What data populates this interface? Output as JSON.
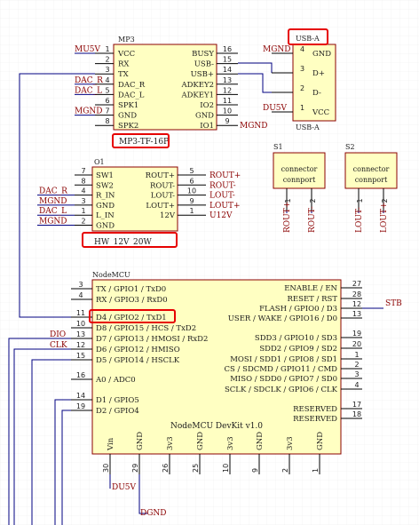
{
  "colors": {
    "body_fill": "#ffffc2",
    "body_stroke": "#8b0000",
    "wire": "#000080",
    "net_label": "#8b0000",
    "highlight": "#e60000",
    "grid": "#e6e6e6"
  },
  "components": {
    "mp3": {
      "designator": "MP3",
      "comment": "MP3-TF-16P",
      "left_pins": [
        {
          "num": "1",
          "name": "VCC",
          "net": "MU5V"
        },
        {
          "num": "2",
          "name": "RX",
          "net": ""
        },
        {
          "num": "3",
          "name": "TX",
          "net": ""
        },
        {
          "num": "4",
          "name": "DAC_R",
          "net": "DAC_R"
        },
        {
          "num": "5",
          "name": "DAC_L",
          "net": "DAC_L"
        },
        {
          "num": "6",
          "name": "SPK1",
          "net": ""
        },
        {
          "num": "7",
          "name": "GND",
          "net": "MGND"
        },
        {
          "num": "8",
          "name": "SPK2",
          "net": ""
        }
      ],
      "right_pins": [
        {
          "num": "16",
          "name": "BUSY",
          "net": ""
        },
        {
          "num": "15",
          "name": "USB-",
          "net": ""
        },
        {
          "num": "14",
          "name": "USB+",
          "net": ""
        },
        {
          "num": "13",
          "name": "ADKEY2",
          "net": ""
        },
        {
          "num": "12",
          "name": "ADKEY1",
          "net": ""
        },
        {
          "num": "11",
          "name": "IO2",
          "net": ""
        },
        {
          "num": "10",
          "name": "GND",
          "net": ""
        },
        {
          "num": "9",
          "name": "IO1",
          "net": "MGND"
        }
      ]
    },
    "usb": {
      "designator": "USB-A",
      "comment": "USB-A",
      "pins": [
        {
          "num": "4",
          "name": "GND",
          "net": "MGND"
        },
        {
          "num": "3",
          "name": "D+",
          "net": ""
        },
        {
          "num": "2",
          "name": "D-",
          "net": ""
        },
        {
          "num": "1",
          "name": "VCC",
          "net": "DU5V"
        }
      ]
    },
    "s1": {
      "designator": "S1",
      "line1": "connector",
      "line2": "connport",
      "pins": [
        {
          "num": "1",
          "net": "ROUT+"
        },
        {
          "num": "2",
          "net": "ROUT-"
        }
      ]
    },
    "s2": {
      "designator": "S2",
      "line1": "connector",
      "line2": "connport",
      "pins": [
        {
          "num": "1",
          "net": "LOUT-"
        },
        {
          "num": "2",
          "net": "LOUT+"
        }
      ]
    },
    "amp": {
      "designator": "O1",
      "comment": "HW_12V_20W",
      "left_pins": [
        {
          "num": "7",
          "name": "SW1",
          "net": ""
        },
        {
          "num": "8",
          "name": "SW2",
          "net": ""
        },
        {
          "num": "4",
          "name": "R_IN",
          "net": "DAC_R"
        },
        {
          "num": "3",
          "name": "GND",
          "net": "MGND"
        },
        {
          "num": "1",
          "name": "L_IN",
          "net": "DAC_L"
        },
        {
          "num": "2",
          "name": "GND",
          "net": "MGND"
        }
      ],
      "right_pins": [
        {
          "num": "5",
          "name": "ROUT+",
          "net": "ROUT+"
        },
        {
          "num": "6",
          "name": "ROUT-",
          "net": "ROUT-"
        },
        {
          "num": "10",
          "name": "LOUT-",
          "net": "LOUT-"
        },
        {
          "num": "9",
          "name": "LOUT+",
          "net": "LOUT+"
        },
        {
          "num": "1",
          "name": "12V",
          "net": "U12V"
        }
      ]
    },
    "mcu": {
      "designator": "NodeMCU",
      "comment": "NodeMCU DevKit v1.0",
      "left_pins": [
        {
          "num": "3",
          "name": "TX / GPIO1 / TxD0",
          "net": ""
        },
        {
          "num": "4",
          "name": "RX / GPIO3 / RxD0",
          "net": ""
        },
        {
          "num": "11",
          "name": "D4 / GPIO2 / TxD1",
          "net": ""
        },
        {
          "num": "10",
          "name": "D8 / GPIO15 / HCS / TxD2",
          "net": ""
        },
        {
          "num": "13",
          "name": "D7 / GPIO13 / HMOSI / RxD2",
          "net": "DIO"
        },
        {
          "num": "12",
          "name": "D6 / GPIO12 / HMISO",
          "net": "CLK"
        },
        {
          "num": "15",
          "name": "D5 / GPIO14 / HSCLK",
          "net": ""
        },
        {
          "num": "16",
          "name": "A0 / ADC0",
          "net": ""
        },
        {
          "num": "14",
          "name": "D1 / GPIO5",
          "net": ""
        },
        {
          "num": "19",
          "name": "D2 / GPIO4",
          "net": ""
        }
      ],
      "right_pins": [
        {
          "num": "27",
          "name": "ENABLE / EN",
          "net": ""
        },
        {
          "num": "28",
          "name": "RESET / RST",
          "net": ""
        },
        {
          "num": "12",
          "name": "FLASH / GPIO0 / D3",
          "net": "STB"
        },
        {
          "num": "13",
          "name": "USER / WAKE / GPIO16 / D0",
          "net": ""
        },
        {
          "num": "19",
          "name": "SDD3 / GPIO10 / SD3",
          "net": ""
        },
        {
          "num": "20",
          "name": "SDD2 / GPIO9 / SD2",
          "net": ""
        },
        {
          "num": "1",
          "name": "MOSI / SDD1 / GPIO8 / SD1",
          "net": ""
        },
        {
          "num": "2",
          "name": "CS / SDCMD / GPIO11 / CMD",
          "net": ""
        },
        {
          "num": "3",
          "name": "MISO / SDD0 / GPIO7 / SD0",
          "net": ""
        },
        {
          "num": "4",
          "name": "SCLK / SDCLK / GPIO6 / CLK",
          "net": ""
        },
        {
          "num": "17",
          "name": "RESERVED",
          "net": ""
        },
        {
          "num": "18",
          "name": "RESERVED",
          "net": ""
        }
      ],
      "bottom_pins": [
        {
          "num": "30",
          "name": "Vin",
          "net": "DU5V"
        },
        {
          "num": "29",
          "name": "GND",
          "net": "DGND"
        },
        {
          "num": "26",
          "name": "3v3",
          "net": ""
        },
        {
          "num": "25",
          "name": "GND",
          "net": ""
        },
        {
          "num": "10",
          "name": "3v3",
          "net": ""
        },
        {
          "num": "9",
          "name": "GND",
          "net": ""
        },
        {
          "num": "2",
          "name": "3v3",
          "net": ""
        },
        {
          "num": "1",
          "name": "GND",
          "net": ""
        }
      ]
    }
  }
}
